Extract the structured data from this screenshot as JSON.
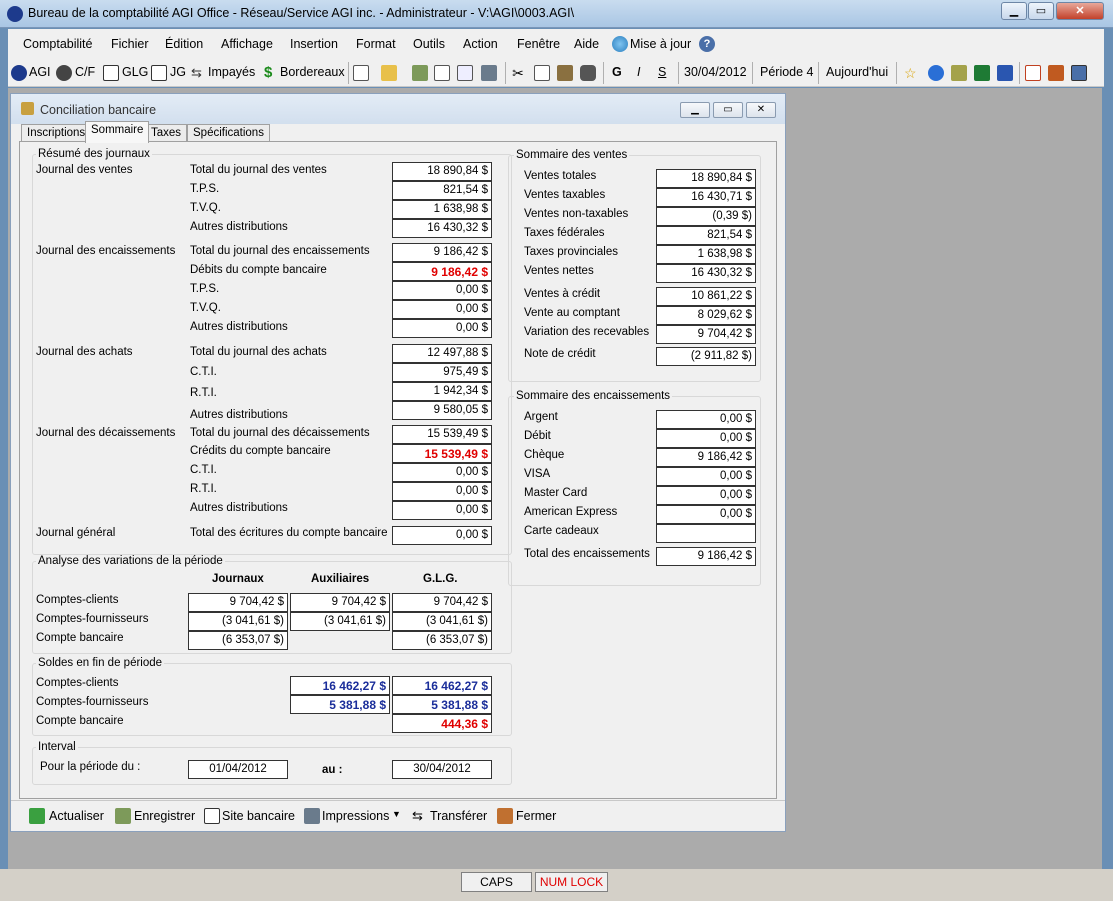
{
  "app": {
    "title": "Bureau de la comptabilité AGI Office - Réseau/Service AGI inc. - Administrateur - V:\\AGI\\0003.AGI\\"
  },
  "menu": [
    "Comptabilité",
    "Fichier",
    "Édition",
    "Affichage",
    "Insertion",
    "Format",
    "Outils",
    "Action",
    "Fenêtre",
    "Aide",
    "Mise à jour"
  ],
  "toolbar": {
    "agi": "AGI",
    "cf": "C/F",
    "glg": "GLG",
    "jg": "JG",
    "impayes": "Impayés",
    "bordereaux": "Bordereaux",
    "bold": "G",
    "italic": "I",
    "underline": "S",
    "date": "30/04/2012",
    "periode": "Période 4",
    "today": "Aujourd'hui"
  },
  "window": {
    "title": "Conciliation bancaire",
    "tabs": [
      "Inscriptions",
      "Sommaire",
      "Taxes",
      "Spécifications"
    ]
  },
  "resume": {
    "title": "Résumé des journaux",
    "ventes": {
      "label": "Journal des ventes",
      "rows": [
        [
          "Total du journal des ventes",
          "18 890,84 $"
        ],
        [
          "T.P.S.",
          "821,54 $"
        ],
        [
          "T.V.Q.",
          "1 638,98 $"
        ],
        [
          "Autres distributions",
          "16 430,32 $"
        ]
      ]
    },
    "encaissements": {
      "label": "Journal des encaissements",
      "rows": [
        [
          "Total du journal des encaissements",
          "9 186,42 $"
        ],
        [
          "Débits du compte bancaire",
          "9 186,42 $"
        ],
        [
          "T.P.S.",
          "0,00 $"
        ],
        [
          "T.V.Q.",
          "0,00 $"
        ],
        [
          "Autres distributions",
          "0,00 $"
        ]
      ]
    },
    "achats": {
      "label": "Journal des achats",
      "rows": [
        [
          "Total du journal des achats",
          "12 497,88 $"
        ],
        [
          "C.T.I.",
          "975,49 $"
        ],
        [
          "R.T.I.",
          "1 942,34 $"
        ],
        [
          "Autres distributions",
          "9 580,05 $"
        ]
      ]
    },
    "decaissements": {
      "label": "Journal des décaissements",
      "rows": [
        [
          "Total du journal des décaissements",
          "15 539,49 $"
        ],
        [
          "Crédits du compte bancaire",
          "15 539,49 $"
        ],
        [
          "C.T.I.",
          "0,00 $"
        ],
        [
          "R.T.I.",
          "0,00 $"
        ],
        [
          "Autres distributions",
          "0,00 $"
        ]
      ]
    },
    "general": {
      "label": "Journal général",
      "rows": [
        [
          "Total des écritures du compte bancaire",
          "0,00 $"
        ]
      ]
    }
  },
  "analyse": {
    "title": "Analyse des variations de la période",
    "headers": [
      "Journaux",
      "Auxiliaires",
      "G.L.G."
    ],
    "rows": [
      {
        "label": "Comptes-clients",
        "vals": [
          "9 704,42 $",
          "9 704,42 $",
          "9 704,42 $"
        ]
      },
      {
        "label": "Comptes-fournisseurs",
        "vals": [
          "(3 041,61 $)",
          "(3 041,61 $)",
          "(3 041,61 $)"
        ]
      },
      {
        "label": "Compte bancaire",
        "vals": [
          "(6 353,07 $)",
          "",
          "(6 353,07 $)"
        ]
      }
    ]
  },
  "soldes": {
    "title": "Soldes en fin de période",
    "rows": [
      {
        "label": "Comptes-clients",
        "aux": "16 462,27 $",
        "glg": "16 462,27 $"
      },
      {
        "label": "Comptes-fournisseurs",
        "aux": "5 381,88 $",
        "glg": "5 381,88 $"
      },
      {
        "label": "Compte bancaire",
        "aux": "",
        "glg": "444,36 $"
      }
    ]
  },
  "interval": {
    "title": "Interval",
    "label": "Pour la période du :",
    "from": "01/04/2012",
    "au": "au :",
    "to": "30/04/2012"
  },
  "sommaire_ventes": {
    "title": "Sommaire des ventes",
    "rows": [
      [
        "Ventes totales",
        "18 890,84 $"
      ],
      [
        "Ventes taxables",
        "16 430,71 $"
      ],
      [
        "Ventes non-taxables",
        "(0,39 $)"
      ],
      [
        "Taxes fédérales",
        "821,54 $"
      ],
      [
        "Taxes provinciales",
        "1 638,98 $"
      ],
      [
        "Ventes nettes",
        "16 430,32 $"
      ],
      [
        "Ventes à crédit",
        "10 861,22 $"
      ],
      [
        "Vente au comptant",
        "8 029,62 $"
      ],
      [
        "Variation des recevables",
        "9 704,42 $"
      ],
      [
        "Note de crédit",
        "(2 911,82 $)"
      ]
    ]
  },
  "sommaire_encaissements": {
    "title": "Sommaire des encaissements",
    "rows": [
      [
        "Argent",
        "0,00 $"
      ],
      [
        "Débit",
        "0,00 $"
      ],
      [
        "Chèque",
        "9 186,42 $"
      ],
      [
        "VISA",
        "0,00 $"
      ],
      [
        "Master Card",
        "0,00 $"
      ],
      [
        "American Express",
        "0,00 $"
      ],
      [
        "Carte cadeaux",
        ""
      ],
      [
        "Total des encaissements",
        "9 186,42 $"
      ]
    ]
  },
  "actions": {
    "actualiser": "Actualiser",
    "enregistrer": "Enregistrer",
    "site": "Site bancaire",
    "impressions": "Impressions",
    "transferer": "Transférer",
    "fermer": "Fermer"
  },
  "status": {
    "caps": "CAPS",
    "numlock": "NUM LOCK"
  }
}
